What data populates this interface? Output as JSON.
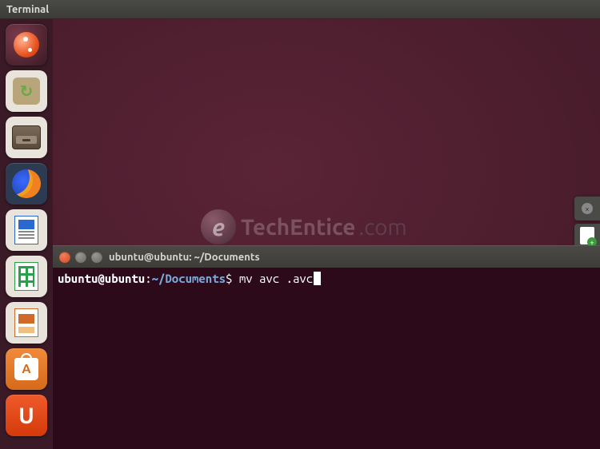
{
  "menubar": {
    "app_label": "Terminal"
  },
  "launcher": {
    "items": [
      {
        "name": "dash",
        "icon": "ubuntu-dash-icon"
      },
      {
        "name": "update",
        "icon": "software-updater-icon"
      },
      {
        "name": "archive",
        "icon": "archive-manager-icon"
      },
      {
        "name": "firefox",
        "icon": "firefox-icon"
      },
      {
        "name": "writer",
        "icon": "libreoffice-writer-icon"
      },
      {
        "name": "calc",
        "icon": "libreoffice-calc-icon"
      },
      {
        "name": "impress",
        "icon": "libreoffice-impress-icon"
      },
      {
        "name": "software",
        "icon": "ubuntu-software-icon"
      },
      {
        "name": "ubuntuone",
        "icon": "ubuntu-one-icon"
      }
    ]
  },
  "watermark": {
    "e": "e",
    "part1": "TechEntice",
    "part2": ".com"
  },
  "terminal": {
    "title": "ubuntu@ubuntu: ~/Documents",
    "prompt_userhost": "ubuntu@ubuntu",
    "prompt_sep1": ":",
    "prompt_path": "~/Documents",
    "prompt_sep2": "$ ",
    "command": "mv avc .avc"
  },
  "notif": {
    "close_label": "×"
  }
}
